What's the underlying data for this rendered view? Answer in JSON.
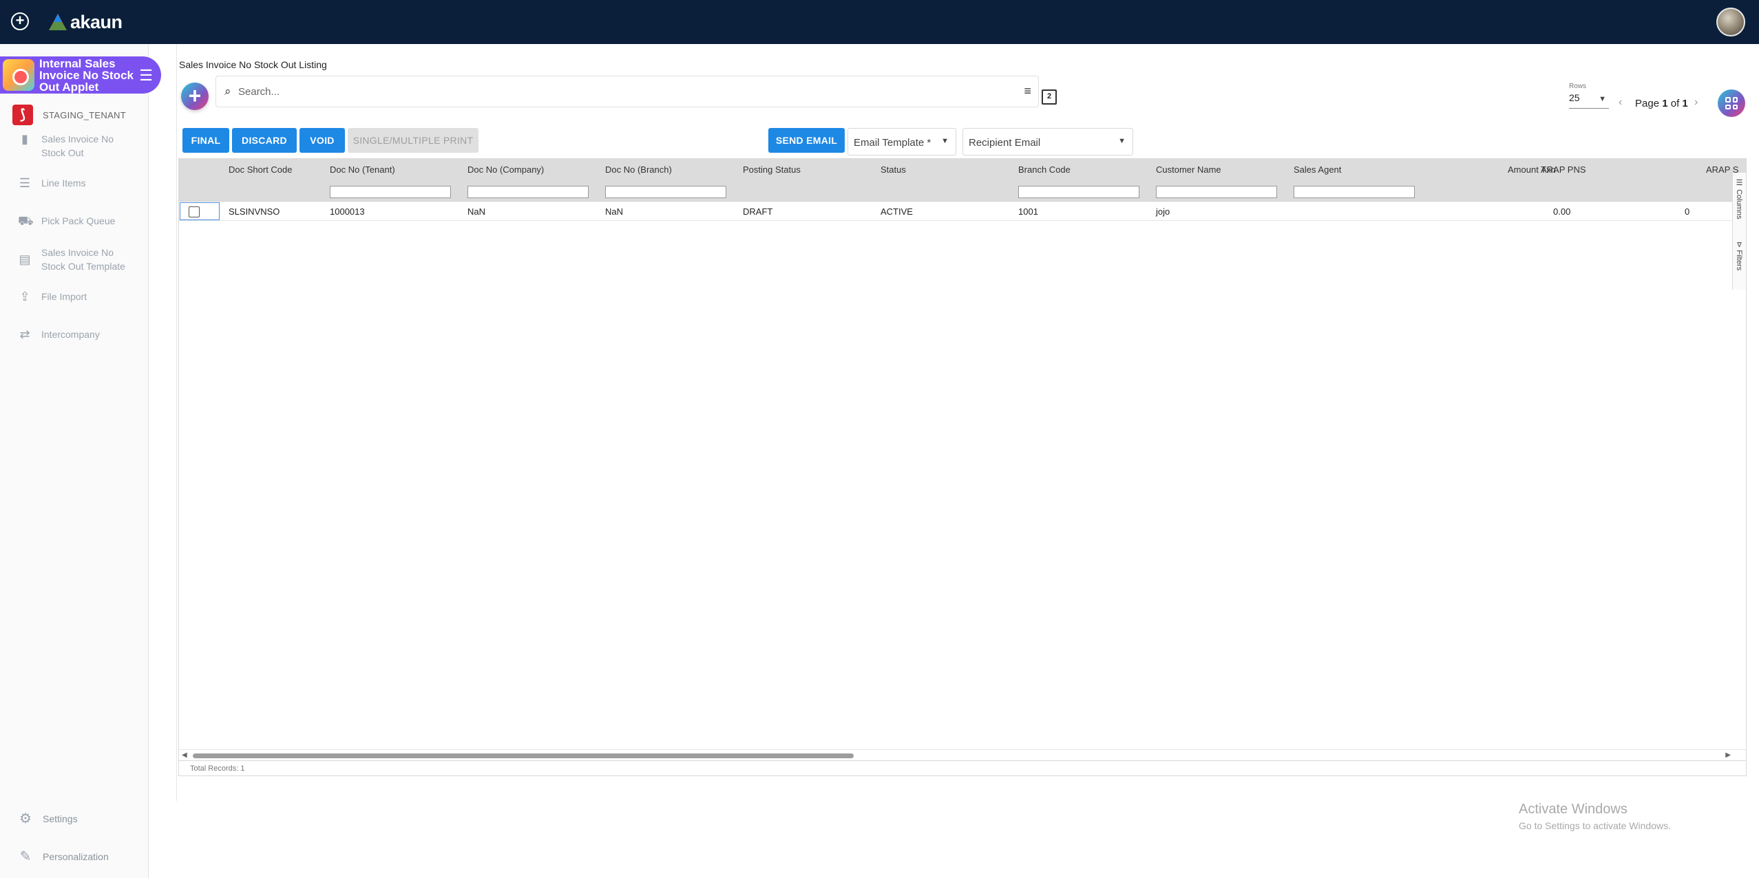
{
  "topbar": {
    "logo_text": "akaun"
  },
  "sidebar": {
    "applet_title": "Internal Sales Invoice No Stock Out Applet",
    "tenant": "STAGING_TENANT",
    "items": [
      {
        "label": "Sales Invoice No Stock Out",
        "icon": "document-icon"
      },
      {
        "label": "Line Items",
        "icon": "list-icon"
      },
      {
        "label": "Pick Pack Queue",
        "icon": "truck-icon"
      },
      {
        "label": "Sales Invoice No Stock Out Template",
        "icon": "template-icon"
      },
      {
        "label": "File Import",
        "icon": "upload-icon"
      },
      {
        "label": "Intercompany",
        "icon": "transfer-icon"
      }
    ],
    "bottom_items": [
      {
        "label": "Settings",
        "icon": "gear-icon"
      },
      {
        "label": "Personalization",
        "icon": "personalization-icon"
      }
    ]
  },
  "main": {
    "title": "Sales Invoice No Stock Out Listing",
    "search_placeholder": "Search...",
    "rows_label": "Rows",
    "rows_value": "25",
    "page_word": "Page",
    "page_current": "1",
    "page_of": "of",
    "page_total": "1",
    "buttons": {
      "final": "FINAL",
      "discard": "DISCARD",
      "void": "VOID",
      "print": "SINGLE/MULTIPLE PRINT",
      "send_email": "SEND EMAIL"
    },
    "email_template_label": "Email Template *",
    "recipient_email_label": "Recipient Email"
  },
  "grid": {
    "columns": [
      "Doc Short Code",
      "Doc No (Tenant)",
      "Doc No (Company)",
      "Doc No (Branch)",
      "Posting Status",
      "Status",
      "Branch Code",
      "Customer Name",
      "Sales Agent",
      "Amount Txn",
      "ARAP PNS",
      "ARAP S"
    ],
    "rows": [
      {
        "doc_short_code": "SLSINVNSO",
        "doc_no_tenant": "1000013",
        "doc_no_company": "NaN",
        "doc_no_branch": "NaN",
        "posting_status": "DRAFT",
        "status": "ACTIVE",
        "branch_code": "1001",
        "customer_name": "jojo",
        "sales_agent": "",
        "amount_txn": "0.00",
        "arap_pns": "0"
      }
    ],
    "side_tabs": [
      "Columns",
      "Filters"
    ],
    "total_records": "Total Records: 1"
  },
  "watermark": {
    "title": "Activate Windows",
    "subtitle": "Go to Settings to activate Windows."
  },
  "colors": {
    "topbar": "#0b1f3a",
    "applet_chip": "#7b52f0",
    "primary_button": "#1e88e5"
  }
}
